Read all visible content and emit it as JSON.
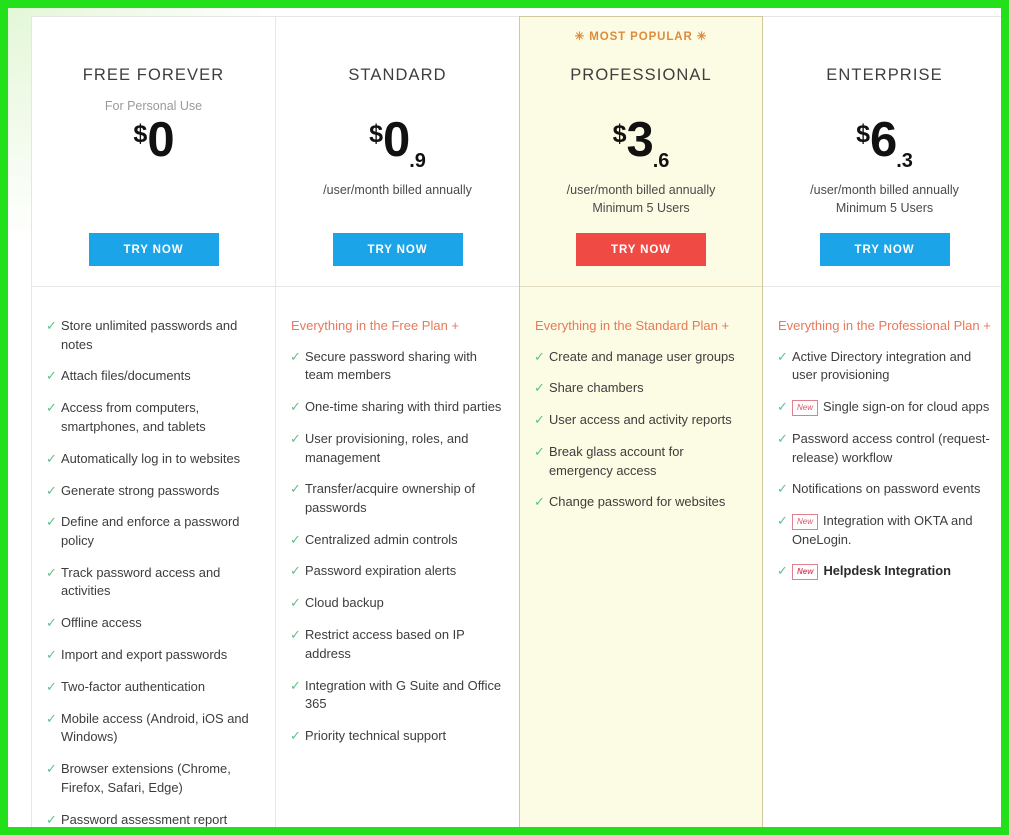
{
  "theme": {
    "outer_border_color": "#22E019",
    "primary_button_color": "#1CA4E8",
    "accent_button_color": "#F04A45",
    "featured_background": "#FCFBE3",
    "heading_accent_color": "#E8795A",
    "popular_badge_color": "#DE8B3B",
    "check_color": "#5FC08A",
    "new_badge_color": "#D9536A"
  },
  "plans": [
    {
      "id": "free-forever",
      "name": "FREE FOREVER",
      "subtitle": "For Personal Use",
      "currency": "$",
      "price": "0",
      "price_decimal": "",
      "billing_note": "",
      "cta_label": "TRY NOW",
      "cta_style": "primary",
      "featured": false,
      "badge": "",
      "features_heading": "",
      "features": [
        {
          "text": "Store unlimited passwords and notes",
          "new": false,
          "bold": false
        },
        {
          "text": "Attach files/documents",
          "new": false,
          "bold": false
        },
        {
          "text": "Access from computers, smartphones, and tablets",
          "new": false,
          "bold": false
        },
        {
          "text": "Automatically log in to websites",
          "new": false,
          "bold": false
        },
        {
          "text": "Generate strong passwords",
          "new": false,
          "bold": false
        },
        {
          "text": "Define and enforce a password policy",
          "new": false,
          "bold": false
        },
        {
          "text": "Track password access and activities",
          "new": false,
          "bold": false
        },
        {
          "text": "Offline access",
          "new": false,
          "bold": false
        },
        {
          "text": "Import and export passwords",
          "new": false,
          "bold": false
        },
        {
          "text": "Two-factor authentication",
          "new": false,
          "bold": false
        },
        {
          "text": "Mobile access (Android, iOS and Windows)",
          "new": false,
          "bold": false
        },
        {
          "text": "Browser extensions (Chrome, Firefox, Safari, Edge)",
          "new": false,
          "bold": false
        },
        {
          "text": "Password assessment report",
          "new": false,
          "bold": false
        }
      ]
    },
    {
      "id": "standard",
      "name": "STANDARD",
      "subtitle": "",
      "currency": "$",
      "price": "0",
      "price_decimal": ".9",
      "billing_note": "/user/month billed annually",
      "cta_label": "TRY NOW",
      "cta_style": "primary",
      "featured": false,
      "badge": "",
      "features_heading": "Everything in the Free Plan +",
      "features": [
        {
          "text": "Secure password sharing with team members",
          "new": false,
          "bold": false
        },
        {
          "text": "One-time sharing with third parties",
          "new": false,
          "bold": false
        },
        {
          "text": "User provisioning, roles, and management",
          "new": false,
          "bold": false
        },
        {
          "text": "Transfer/acquire ownership of passwords",
          "new": false,
          "bold": false
        },
        {
          "text": "Centralized admin controls",
          "new": false,
          "bold": false
        },
        {
          "text": "Password expiration alerts",
          "new": false,
          "bold": false
        },
        {
          "text": "Cloud backup",
          "new": false,
          "bold": false
        },
        {
          "text": "Restrict access based on IP address",
          "new": false,
          "bold": false
        },
        {
          "text": "Integration with G Suite and Office 365",
          "new": false,
          "bold": false
        },
        {
          "text": "Priority technical support",
          "new": false,
          "bold": false
        }
      ]
    },
    {
      "id": "professional",
      "name": "PROFESSIONAL",
      "subtitle": "",
      "currency": "$",
      "price": "3",
      "price_decimal": ".6",
      "billing_note": "/user/month billed annually\nMinimum 5 Users",
      "cta_label": "TRY NOW",
      "cta_style": "accent",
      "featured": true,
      "badge": "✳ MOST POPULAR ✳",
      "features_heading": "Everything in the Standard Plan +",
      "features": [
        {
          "text": "Create and manage user groups",
          "new": false,
          "bold": false
        },
        {
          "text": "Share chambers",
          "new": false,
          "bold": false
        },
        {
          "text": "User access and activity reports",
          "new": false,
          "bold": false
        },
        {
          "text": "Break glass account for emergency access",
          "new": false,
          "bold": false
        },
        {
          "text": "Change password for websites",
          "new": false,
          "bold": false
        }
      ]
    },
    {
      "id": "enterprise",
      "name": "ENTERPRISE",
      "subtitle": "",
      "currency": "$",
      "price": "6",
      "price_decimal": ".3",
      "billing_note": "/user/month billed annually\nMinimum 5 Users",
      "cta_label": "TRY NOW",
      "cta_style": "primary",
      "featured": false,
      "badge": "",
      "features_heading": "Everything in the Professional Plan +",
      "features": [
        {
          "text": "Active Directory integration and user provisioning",
          "new": false,
          "bold": false
        },
        {
          "text": "Single sign-on for cloud apps",
          "new": true,
          "bold": false
        },
        {
          "text": "Password access control (request-release) workflow",
          "new": false,
          "bold": false
        },
        {
          "text": "Notifications on password events",
          "new": false,
          "bold": false
        },
        {
          "text": "Integration with OKTA and OneLogin.",
          "new": true,
          "bold": false
        },
        {
          "text": "Helpdesk Integration",
          "new": true,
          "bold": true
        }
      ]
    }
  ],
  "labels": {
    "new_badge": "New",
    "check_glyph": "✓"
  }
}
